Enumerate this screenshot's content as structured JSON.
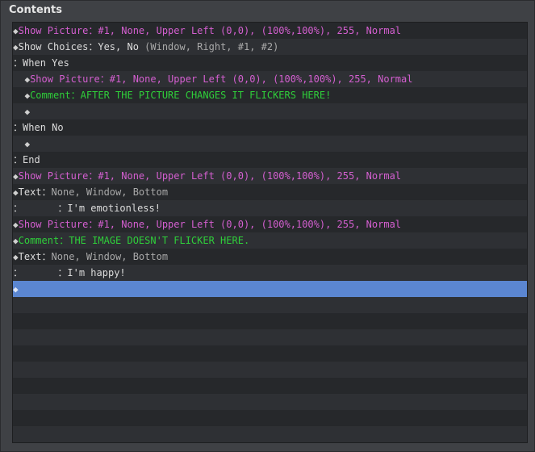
{
  "panel_title": "Contents",
  "colors": {
    "selection": "#5b86d1",
    "picture": "#d45fd0",
    "comment": "#2fce3a"
  },
  "commands": [
    {
      "indent": "",
      "marker": "◆",
      "cmd": "Show Picture",
      "sep": "：",
      "args": "#1, None, Upper Left (0,0), (100%,100%), 255, Normal",
      "extra": ""
    },
    {
      "indent": "",
      "marker": "◆",
      "cmd": "Show Choices",
      "sep": "：",
      "args": "Yes, No",
      "extra": " (Window, Right, #1, #2)"
    },
    {
      "indent": "",
      "marker": "：",
      "cmd": "When Yes",
      "sep": "",
      "args": "",
      "extra": ""
    },
    {
      "indent": "  ",
      "marker": "◆",
      "cmd": "Show Picture",
      "sep": "：",
      "args": "#1, None, Upper Left (0,0), (100%,100%), 255, Normal",
      "extra": ""
    },
    {
      "indent": "  ",
      "marker": "◆",
      "cmd": "Comment",
      "sep": "：",
      "args": "AFTER THE PICTURE CHANGES IT FLICKERS HERE!",
      "extra": ""
    },
    {
      "indent": "  ",
      "marker": "◆",
      "cmd": "",
      "sep": "",
      "args": "",
      "extra": ""
    },
    {
      "indent": "",
      "marker": "：",
      "cmd": "When No",
      "sep": "",
      "args": "",
      "extra": ""
    },
    {
      "indent": "  ",
      "marker": "◆",
      "cmd": "",
      "sep": "",
      "args": "",
      "extra": ""
    },
    {
      "indent": "",
      "marker": "：",
      "cmd": "End",
      "sep": "",
      "args": "",
      "extra": ""
    },
    {
      "indent": "",
      "marker": "◆",
      "cmd": "Show Picture",
      "sep": "：",
      "args": "#1, None, Upper Left (0,0), (100%,100%), 255, Normal",
      "extra": ""
    },
    {
      "indent": "",
      "marker": "◆",
      "cmd": "Text",
      "sep": "：",
      "args": "None, Window, Bottom",
      "extra": ""
    },
    {
      "indent": "",
      "marker": "：",
      "cmd": "      ",
      "sep": "：",
      "args": "I'm emotionless!",
      "extra": ""
    },
    {
      "indent": "",
      "marker": "◆",
      "cmd": "Show Picture",
      "sep": "：",
      "args": "#1, None, Upper Left (0,0), (100%,100%), 255, Normal",
      "extra": ""
    },
    {
      "indent": "",
      "marker": "◆",
      "cmd": "Comment",
      "sep": "：",
      "args": "THE IMAGE DOESN'T FLICKER HERE.",
      "extra": ""
    },
    {
      "indent": "",
      "marker": "◆",
      "cmd": "Text",
      "sep": "：",
      "args": "None, Window, Bottom",
      "extra": ""
    },
    {
      "indent": "",
      "marker": "：",
      "cmd": "      ",
      "sep": "：",
      "args": "I'm happy!",
      "extra": ""
    },
    {
      "indent": "",
      "marker": "◆",
      "cmd": "",
      "sep": "",
      "args": "",
      "extra": ""
    }
  ]
}
